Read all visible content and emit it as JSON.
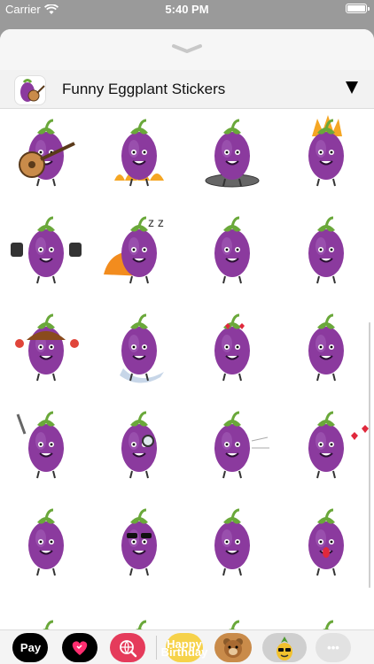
{
  "status_bar": {
    "carrier": "Carrier",
    "time": "5:40 PM"
  },
  "header": {
    "title": "Funny Eggplant Stickers"
  },
  "app_strip": {
    "apple_pay_label": "Pay",
    "birthday_label_1": "Happy",
    "birthday_label_2": "Birthday",
    "more_label": "•••"
  },
  "stickers": [
    "guitar",
    "ghost-fire",
    "spinning",
    "angry-fire",
    "weights",
    "sleeping",
    "grinning",
    "laughing",
    "maracas",
    "melting",
    "in-love",
    "flexing",
    "selfie",
    "detective",
    "running",
    "kissing",
    "winking",
    "sunglasses",
    "smiling",
    "tongue-out",
    "partial-1",
    "partial-2",
    "partial-3",
    "partial-4"
  ],
  "colors": {
    "eggplant": "#8b3a9e",
    "eggplant_light": "#a45db8",
    "stem": "#6aa83a"
  }
}
